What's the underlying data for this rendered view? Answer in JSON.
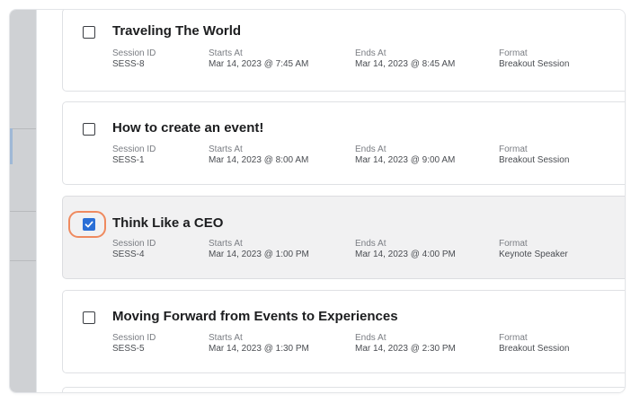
{
  "sessions": [
    {
      "title": "Traveling The World",
      "checked": false,
      "session_id_label": "Session ID",
      "session_id": "SESS-8",
      "starts_label": "Starts At",
      "starts": "Mar 14, 2023 @ 7:45 AM",
      "ends_label": "Ends At",
      "ends": "Mar 14, 2023 @ 8:45 AM",
      "format_label": "Format",
      "format": "Breakout Session"
    },
    {
      "title": "How to create an event!",
      "checked": false,
      "session_id_label": "Session ID",
      "session_id": "SESS-1",
      "starts_label": "Starts At",
      "starts": "Mar 14, 2023 @ 8:00 AM",
      "ends_label": "Ends At",
      "ends": "Mar 14, 2023 @ 9:00 AM",
      "format_label": "Format",
      "format": "Breakout Session"
    },
    {
      "title": "Think Like a CEO",
      "checked": true,
      "session_id_label": "Session ID",
      "session_id": "SESS-4",
      "starts_label": "Starts At",
      "starts": "Mar 14, 2023 @ 1:00 PM",
      "ends_label": "Ends At",
      "ends": "Mar 14, 2023 @ 4:00 PM",
      "format_label": "Format",
      "format": "Keynote Speaker"
    },
    {
      "title": "Moving Forward from Events to Experiences",
      "checked": false,
      "session_id_label": "Session ID",
      "session_id": "SESS-5",
      "starts_label": "Starts At",
      "starts": "Mar 14, 2023 @ 1:30 PM",
      "ends_label": "Ends At",
      "ends": "Mar 14, 2023 @ 2:30 PM",
      "format_label": "Format",
      "format": "Breakout Session"
    }
  ],
  "colors": {
    "checkbox_checked": "#2b6fd6",
    "focus_ring": "#ef8a5f",
    "selected_card_bg": "#f1f1f2"
  },
  "icons": {
    "checked_mark": "checkmark-icon"
  }
}
